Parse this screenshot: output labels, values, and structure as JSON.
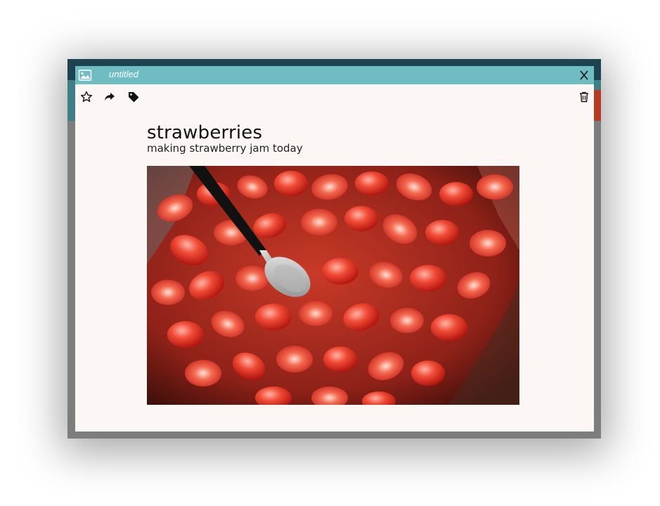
{
  "window": {
    "title": "untitled"
  },
  "toolbar": {
    "icons": [
      "star-icon",
      "share-icon",
      "tag-icon",
      "trash-icon"
    ]
  },
  "note": {
    "title": "strawberries",
    "subtitle": "making strawberry jam today",
    "image": "strawberries-in-bowl-with-spoon"
  },
  "colors": {
    "titlebar": "#6fbcc2",
    "window_background": "#fcf7f5",
    "frame_outer": "#7d7d7d",
    "strawberry_red": "#e03a2a"
  }
}
